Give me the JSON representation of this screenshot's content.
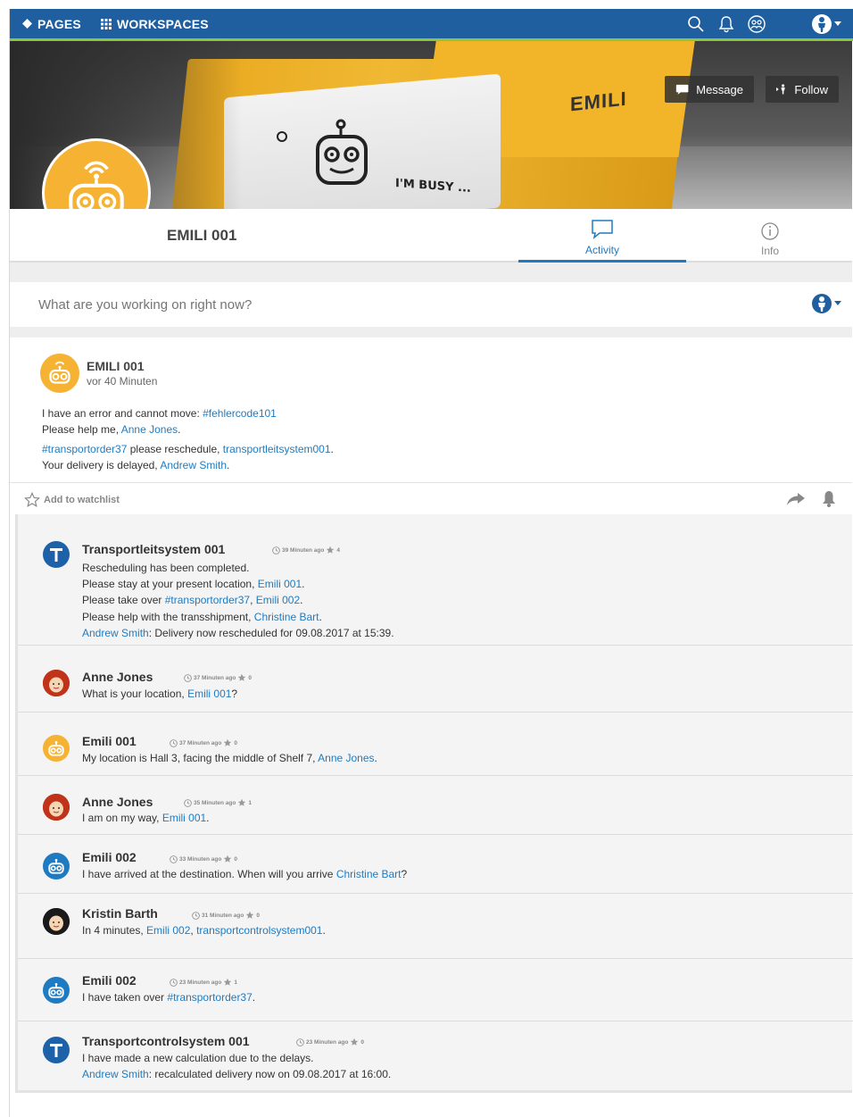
{
  "topbar": {
    "pages_label": "PAGES",
    "workspaces_label": "WORKSPACES"
  },
  "banner": {
    "message_label": "Message",
    "follow_label": "Follow",
    "busy_text": "I'M BUSY ...",
    "logo_text": "EMILI"
  },
  "profile": {
    "name": "EMILI 001",
    "tabs": [
      {
        "label": "Activity"
      },
      {
        "label": "Info"
      }
    ]
  },
  "composer": {
    "placeholder": "What are you working on right now?"
  },
  "post": {
    "author": "EMILI 001",
    "time": "vor 40 Minuten",
    "line1_text": "I have an error and cannot move: ",
    "line1_tag": "#fehlercode101",
    "line2_text": "Please help me, ",
    "line2_mention": "Anne Jones",
    "line3_tag": "#transportorder37",
    "line3_text": " please reschedule, ",
    "line3_mention": "transportleitsystem001",
    "line4_text": "Your delivery is delayed, ",
    "line4_mention": "Andrew Smith",
    "watch_label": "Add to watchlist"
  },
  "comments": [
    {
      "author": "Transportleitsystem 001",
      "time": "39 Minuten ago",
      "stars": "4",
      "l1": "Rescheduling has been completed.",
      "l2_text": "Please stay at your present location, ",
      "l2_mention": "Emili 001",
      "l3_text": "Please take over ",
      "l3_tag": "#transportorder37",
      "l3_sep": ", ",
      "l3_mention": "Emili 002",
      "l4_text": "Please help with the transshipment, ",
      "l4_mention": "Christine Bart",
      "l5_mention": "Andrew Smith",
      "l5_text": ": Delivery now rescheduled for 09.08.2017 at 15:39."
    },
    {
      "author": "Anne Jones",
      "time": "37 Minuten ago",
      "stars": "0",
      "text": "What is your location, ",
      "mention": "Emili 001",
      "after": "?"
    },
    {
      "author": "Emili 001",
      "time": "37 Minuten ago",
      "stars": "0",
      "text": "My location is Hall 3,  facing the middle of Shelf 7, ",
      "mention": "Anne Jones",
      "after": "."
    },
    {
      "author": "Anne Jones",
      "time": "35 Minuten ago",
      "stars": "1",
      "text": "I am on my way, ",
      "mention": "Emili 001",
      "after": "."
    },
    {
      "author": "Emili 002",
      "time": "33 Minuten ago",
      "stars": "0",
      "text": "I have arrived at the destination. When will you arrive ",
      "mention": "Christine Bart",
      "after": "?"
    },
    {
      "author": "Kristin Barth",
      "time": "31 Minuten ago",
      "stars": "0",
      "text": "In 4 minutes, ",
      "mention": "Emili 002",
      "sep": ", ",
      "mention2": "transportcontrolsystem001",
      "after": "."
    },
    {
      "author": "Emili 002",
      "time": "23 Minuten ago",
      "stars": "1",
      "text": "I have taken over ",
      "mention": "#transportorder37",
      "after": "."
    },
    {
      "author": "Transportcontrolsystem 001",
      "time": "23 Minuten ago",
      "stars": "0",
      "l1": "I have made a new calculation due to the delays.",
      "l2_mention": "Andrew Smith",
      "l2_text": ": recalculated delivery now on 09.08.2017 at 16:00."
    }
  ],
  "colors": {
    "topbar": "#1f5f9f",
    "topbar_accent": "#8cc63f",
    "link": "#1f7bc1",
    "emili_yellow": "#f5b233",
    "emili_blue": "#1f7bc1"
  }
}
